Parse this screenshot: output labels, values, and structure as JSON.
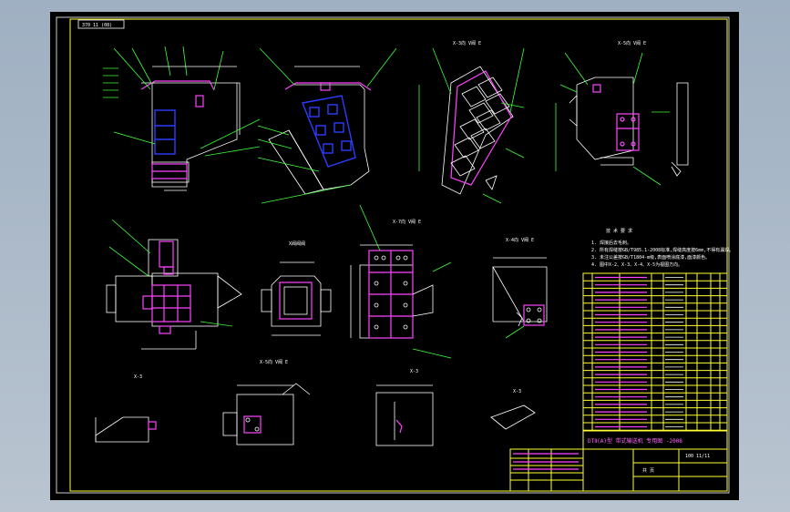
{
  "drawing": {
    "corner_tag": "370 11 (08)",
    "views": [
      {
        "id": "v1",
        "label": ""
      },
      {
        "id": "v2",
        "label": ""
      },
      {
        "id": "v3",
        "label": "X-3向 V阀 E"
      },
      {
        "id": "v4",
        "label": "X-5向 V阀 E"
      },
      {
        "id": "v5",
        "label": ""
      },
      {
        "id": "v6",
        "label": "X阀阀阀"
      },
      {
        "id": "v7",
        "label": "X-7向 V阀 E"
      },
      {
        "id": "v8",
        "label": "X-4向 V阀 E"
      },
      {
        "id": "v9",
        "label": "X-3"
      },
      {
        "id": "v10",
        "label": "X-5向 V阀 E"
      },
      {
        "id": "v11",
        "label": "X-3"
      },
      {
        "id": "v12",
        "label": "X-3"
      }
    ],
    "notes_title": "技 术 要 求",
    "notes": [
      "1. 焊接后去毛刺。",
      "2. 所有焊缝按GB/T985.1-2008标准,焊缝高度按6mm,不得有漏焊。",
      "3. 未注公差按GB/T1804-m级,表面喷涂底漆,面漆颜色。",
      "4. 图中X-2、X-3、X-4、X-5为视图方向。"
    ],
    "title_block": {
      "company": "DTⅡ(A)型 带式输送机 专用图 -2008",
      "drawing_no": "100 11/11",
      "sheet": "共 页"
    }
  }
}
